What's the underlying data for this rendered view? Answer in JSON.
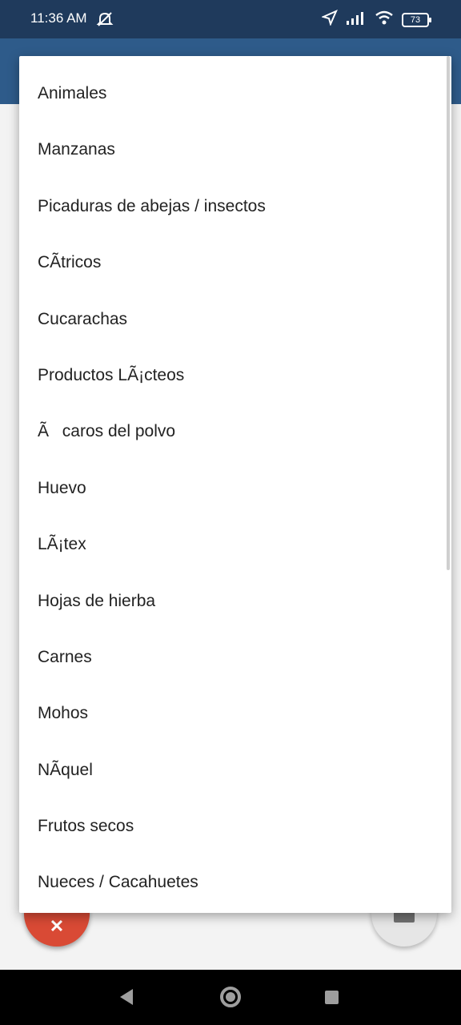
{
  "status_bar": {
    "time": "11:36 AM",
    "battery": "73",
    "icons": [
      "mute-icon",
      "location-icon",
      "signal-icon",
      "wifi-icon",
      "battery-icon"
    ]
  },
  "menu": {
    "items": [
      "Animales",
      "Manzanas",
      "Picaduras de abejas / insectos",
      "CÃtricos",
      "Cucarachas",
      "Productos LÃ¡cteos",
      "Ãcaros del polvo",
      "Huevo",
      "LÃ¡tex",
      "Hojas de hierba",
      "Carnes",
      "Mohos",
      "NÃquel",
      "Frutos secos",
      "Nueces / Cacahuetes"
    ]
  },
  "fabs": {
    "delete_icon": "close-icon",
    "camera_icon": "camera-icon"
  },
  "colors": {
    "status_bar": "#1f3a5c",
    "app_bar": "#2e5b8a",
    "fab_delete": "#d94a35"
  }
}
